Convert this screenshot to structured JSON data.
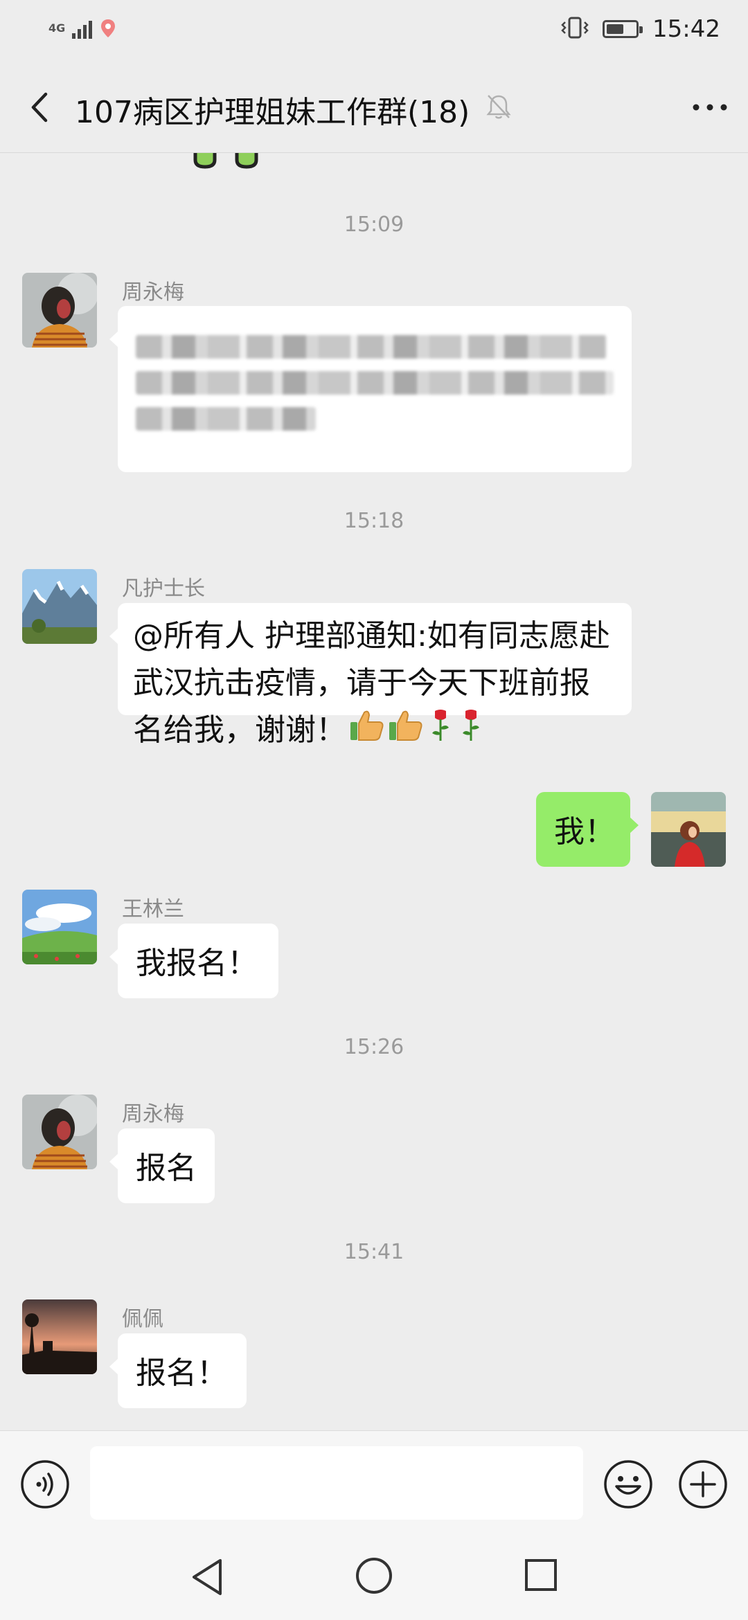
{
  "status_bar": {
    "network": "4G",
    "signal_level": 0.8,
    "battery_level": 0.6,
    "time": "15:42"
  },
  "header": {
    "title": "107病区护理姐妹工作群(18)",
    "muted": true
  },
  "chat": {
    "messages": [
      {
        "timestamp": "15:09",
        "sender": "周永梅",
        "redacted": true
      },
      {
        "timestamp": "15:18",
        "sender": "凡护士长",
        "text": "@所有人 护理部通知:如有同志愿赴武汉抗击疫情，请于今天下班前报名给我，谢谢！",
        "emojis": [
          "thumbs-up",
          "thumbs-up",
          "rose",
          "rose"
        ]
      },
      {
        "sender": "me",
        "text": "我！"
      },
      {
        "sender": "王林兰",
        "text": "我报名！"
      },
      {
        "timestamp": "15:26",
        "sender": "周永梅",
        "text": "报名"
      },
      {
        "timestamp": "15:41",
        "sender": "佩佩",
        "text": "报名！"
      }
    ]
  },
  "input_bar": {
    "placeholder": "",
    "icons": [
      "voice-icon",
      "emoji-icon",
      "plus-icon"
    ]
  },
  "nav_bar": {
    "icons": [
      "nav-back-icon",
      "nav-home-icon",
      "nav-recent-icon"
    ]
  },
  "colors": {
    "background": "#ededed",
    "bubble_self": "#95ec69",
    "bubble_other": "#ffffff",
    "timestamp": "#9a9a9a"
  }
}
